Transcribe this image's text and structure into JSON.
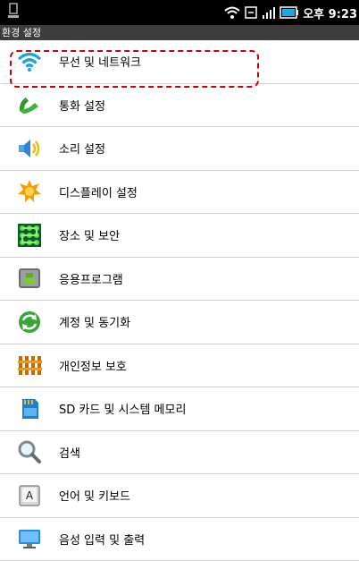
{
  "status_bar": {
    "time": "오후 9:23",
    "icons": [
      "usb-icon",
      "wifi-icon",
      "sync-icon",
      "signal-icon",
      "battery-icon"
    ]
  },
  "header": {
    "title": "환경 설정"
  },
  "settings": {
    "items": [
      {
        "label": "무선 및 네트워크",
        "icon": "wifi-icon",
        "highlighted": true
      },
      {
        "label": "통화 설정",
        "icon": "phone-handset-icon"
      },
      {
        "label": "소리 설정",
        "icon": "speaker-icon"
      },
      {
        "label": "디스플레이 설정",
        "icon": "brightness-icon"
      },
      {
        "label": "장소 및 보안",
        "icon": "pattern-lock-icon"
      },
      {
        "label": "응용프로그램",
        "icon": "android-icon"
      },
      {
        "label": "계정 및 동기화",
        "icon": "sync-icon"
      },
      {
        "label": "개인정보 보호",
        "icon": "fence-icon"
      },
      {
        "label": "SD 카드 및 시스템 메모리",
        "icon": "sd-card-icon"
      },
      {
        "label": "검색",
        "icon": "magnifier-icon"
      },
      {
        "label": "언어 및 키보드",
        "icon": "keyboard-key-icon"
      },
      {
        "label": "음성 입력 및 출력",
        "icon": "monitor-icon"
      }
    ]
  },
  "colors": {
    "status_bar_bg": "#000000",
    "title_bar_bg": "#3d3d3d",
    "divider": "#d2d2d2",
    "highlight_border": "#d10000"
  }
}
